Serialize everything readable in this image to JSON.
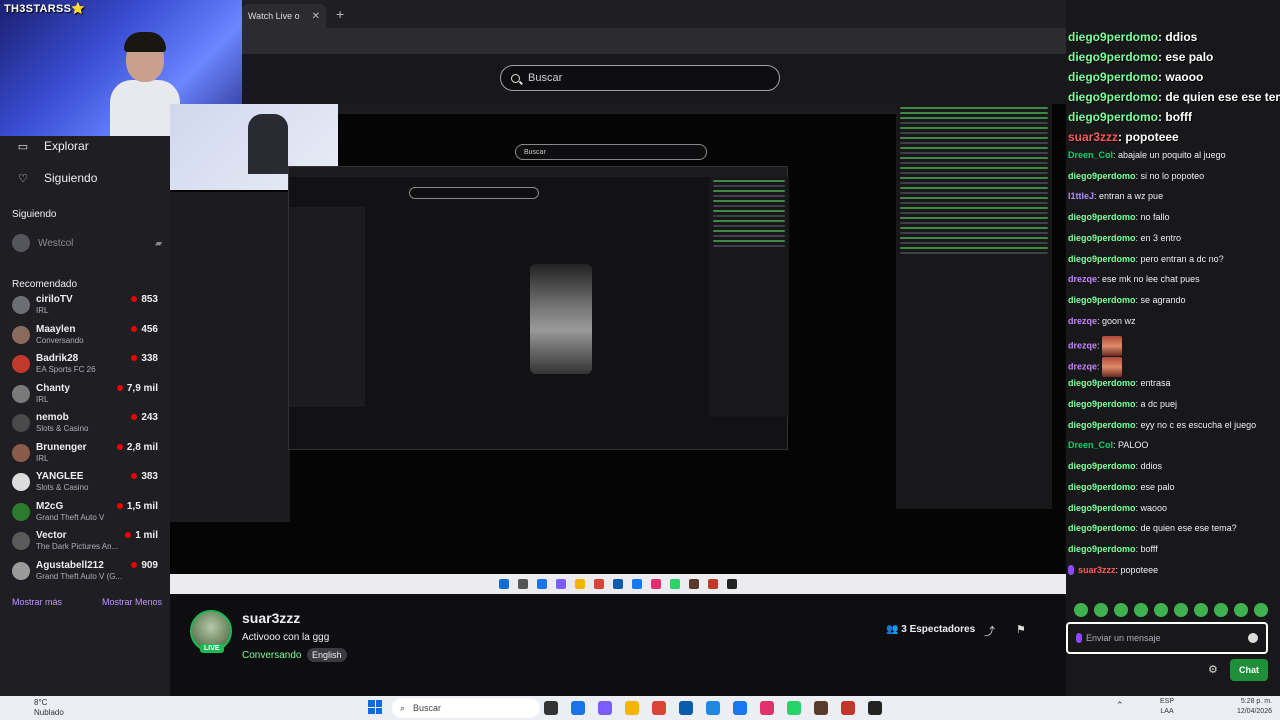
{
  "webcam": {
    "name": "TH3STARSS⭐"
  },
  "browser": {
    "tab_label": "Watch Live o",
    "tab_close": "✕",
    "new_tab": "+",
    "search_placeholder": "Buscar"
  },
  "sidebar": {
    "explore": "Explorar",
    "following": "Siguiendo",
    "following_section": "Siguiendo",
    "followed_channel": "Westcol",
    "recommended_section": "Recomendado",
    "show_more": "Mostrar más",
    "show_less": "Mostrar Menos",
    "channels": [
      {
        "name": "ciriloTV",
        "game": "IRL",
        "viewers": "853",
        "color": "#6d6d74"
      },
      {
        "name": "Maaylen",
        "game": "Conversando",
        "viewers": "456",
        "color": "#8a6a5a"
      },
      {
        "name": "Badrik28",
        "game": "EA Sports FC 26",
        "viewers": "338",
        "color": "#c0392b"
      },
      {
        "name": "Chanty",
        "game": "IRL",
        "viewers": "7,9 mil",
        "color": "#7a7a7a"
      },
      {
        "name": "nemob",
        "game": "Slots & Casino",
        "viewers": "243",
        "color": "#4a4a4a"
      },
      {
        "name": "Brunenger",
        "game": "IRL",
        "viewers": "2,8 mil",
        "color": "#8a5a4a"
      },
      {
        "name": "YANGLEE",
        "game": "Slots & Casino",
        "viewers": "383",
        "color": "#dcdcdc"
      },
      {
        "name": "M2cG",
        "game": "Grand Theft Auto V",
        "viewers": "1,5 mil",
        "color": "#2c7a2c"
      },
      {
        "name": "Vector",
        "game": "The Dark Pictures An...",
        "viewers": "1 mil",
        "color": "#5a5a5a"
      },
      {
        "name": "Agustabell212",
        "game": "Grand Theft Auto V (G...",
        "viewers": "909",
        "color": "#9a9a9a"
      }
    ]
  },
  "chat": {
    "messages": [
      {
        "user": "diego9perdomo",
        "text": "ddios",
        "color": "#7bff9b",
        "big": true
      },
      {
        "user": "diego9perdomo",
        "text": "ese palo",
        "color": "#7bff9b",
        "big": true
      },
      {
        "user": "diego9perdomo",
        "text": "waooo",
        "color": "#7bff9b",
        "big": true
      },
      {
        "user": "diego9perdomo",
        "text": "de quien ese ese tema?",
        "color": "#7bff9b",
        "big": true
      },
      {
        "user": "diego9perdomo",
        "text": "bofff",
        "color": "#7bff9b",
        "big": true
      },
      {
        "user": "suar3zzz",
        "text": "popoteee",
        "color": "#ff5b5b",
        "big": true
      },
      {
        "user": "Dreen_Col",
        "text": "abajale un poquito al juego",
        "color": "#00d66c",
        "big": false
      },
      {
        "user": "diego9perdomo",
        "text": "si no lo popoteo",
        "color": "#7bff9b",
        "big": false
      },
      {
        "user": "l1ttleJ",
        "text": "entran a wz pue",
        "color": "#b18aff",
        "big": false
      },
      {
        "user": "diego9perdomo",
        "text": "no fallo",
        "color": "#7bff9b",
        "big": false
      },
      {
        "user": "diego9perdomo",
        "text": "en 3 entro",
        "color": "#7bff9b",
        "big": false
      },
      {
        "user": "diego9perdomo",
        "text": "pero entran a dc no?",
        "color": "#7bff9b",
        "big": false
      },
      {
        "user": "drezqe",
        "text": "ese mk no lee chat pues",
        "color": "#c782ff",
        "big": false
      },
      {
        "user": "diego9perdomo",
        "text": "se agrando",
        "color": "#7bff9b",
        "big": false
      },
      {
        "user": "drezqe",
        "text": "goon wz",
        "color": "#c782ff",
        "big": false
      },
      {
        "user": "drezqe",
        "text": "",
        "color": "#c782ff",
        "big": false,
        "emote": true
      },
      {
        "user": "drezqe",
        "text": "",
        "color": "#c782ff",
        "big": false,
        "emote": true
      },
      {
        "user": "diego9perdomo",
        "text": "entrasa",
        "color": "#7bff9b",
        "big": false
      },
      {
        "user": "diego9perdomo",
        "text": "a dc puej",
        "color": "#7bff9b",
        "big": false
      },
      {
        "user": "diego9perdomo",
        "text": "eyy no c es escucha el juego",
        "color": "#7bff9b",
        "big": false
      },
      {
        "user": "Dreen_Col",
        "text": "PALOO",
        "color": "#00d66c",
        "big": false
      },
      {
        "user": "diego9perdomo",
        "text": "ddios",
        "color": "#7bff9b",
        "big": false
      },
      {
        "user": "diego9perdomo",
        "text": "ese palo",
        "color": "#7bff9b",
        "big": false
      },
      {
        "user": "diego9perdomo",
        "text": "waooo",
        "color": "#7bff9b",
        "big": false
      },
      {
        "user": "diego9perdomo",
        "text": "de quien ese ese tema?",
        "color": "#7bff9b",
        "big": false
      },
      {
        "user": "diego9perdomo",
        "text": "bofff",
        "color": "#7bff9b",
        "big": false
      },
      {
        "user": "suar3zzz",
        "text": "popoteee",
        "color": "#ff5b5b",
        "big": false,
        "mic": true
      }
    ],
    "input_placeholder": "Enviar un mensaje",
    "chat_button": "Chat"
  },
  "stream": {
    "streamer": "suar3zzz",
    "live": "LIVE",
    "title": "Activooo con la ggg",
    "category": "Conversando",
    "tag": "English",
    "viewers": "3 Espectadores"
  },
  "taskbar": {
    "temp": "8°C",
    "weather": "Nublado",
    "search": "Buscar",
    "lang1": "ESP",
    "lang2": "LAA",
    "time": "5:28 p. m.",
    "date": "12/04/2026"
  }
}
